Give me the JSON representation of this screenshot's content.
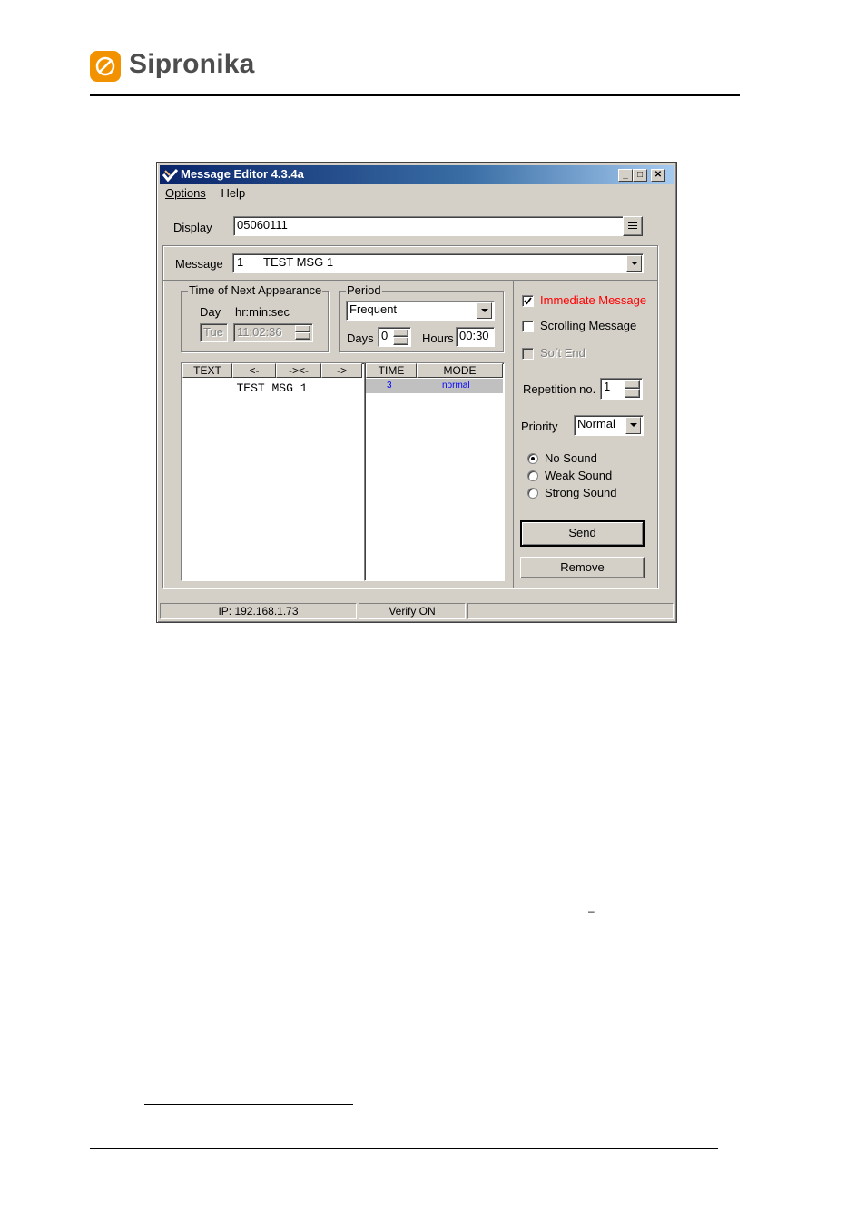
{
  "brand": {
    "name": "Sipronika",
    "accent": "#f39200"
  },
  "window": {
    "title": "Message Editor 4.3.4a",
    "caption_buttons": [
      "minimize-icon",
      "maximize-icon",
      "close-icon"
    ],
    "menu": [
      "Options",
      "Help"
    ]
  },
  "display": {
    "label": "Display",
    "value": "05060111"
  },
  "message": {
    "label": "Message",
    "number": "1",
    "text": "TEST MSG 1"
  },
  "next_appearance": {
    "legend": "Time of Next Appearance",
    "day_label": "Day",
    "time_label": "hr:min:sec",
    "day_value": "Tue",
    "time_value": "11:02:36"
  },
  "period": {
    "legend": "Period",
    "selected": "Frequent",
    "days_label": "Days",
    "days_value": "0",
    "hours_label": "Hours",
    "hours_value": "00:30"
  },
  "text_list": {
    "headers": [
      "TEXT",
      "<-",
      "-><-",
      "->"
    ],
    "rows": [
      "TEST MSG 1"
    ]
  },
  "time_list": {
    "headers": [
      "TIME",
      "MODE"
    ],
    "rows": [
      {
        "time": "3",
        "mode": "normal"
      }
    ]
  },
  "options": {
    "immediate": {
      "label": "Immediate Message",
      "checked": true,
      "color": "#ff0000"
    },
    "scrolling": {
      "label": "Scrolling Message",
      "checked": false
    },
    "soft_end": {
      "label": "Soft End",
      "checked": false,
      "disabled": true
    }
  },
  "repetition": {
    "label": "Repetition no.",
    "value": "1"
  },
  "priority": {
    "label": "Priority",
    "value": "Normal"
  },
  "sound": {
    "options": [
      "No Sound",
      "Weak Sound",
      "Strong Sound"
    ],
    "selected": "No Sound"
  },
  "buttons": {
    "send": "Send",
    "remove": "Remove"
  },
  "status": {
    "ip": "IP: 192.168.1.73",
    "verify": "Verify ON",
    "extra": ""
  },
  "page": {
    "stray_mark": "–"
  }
}
